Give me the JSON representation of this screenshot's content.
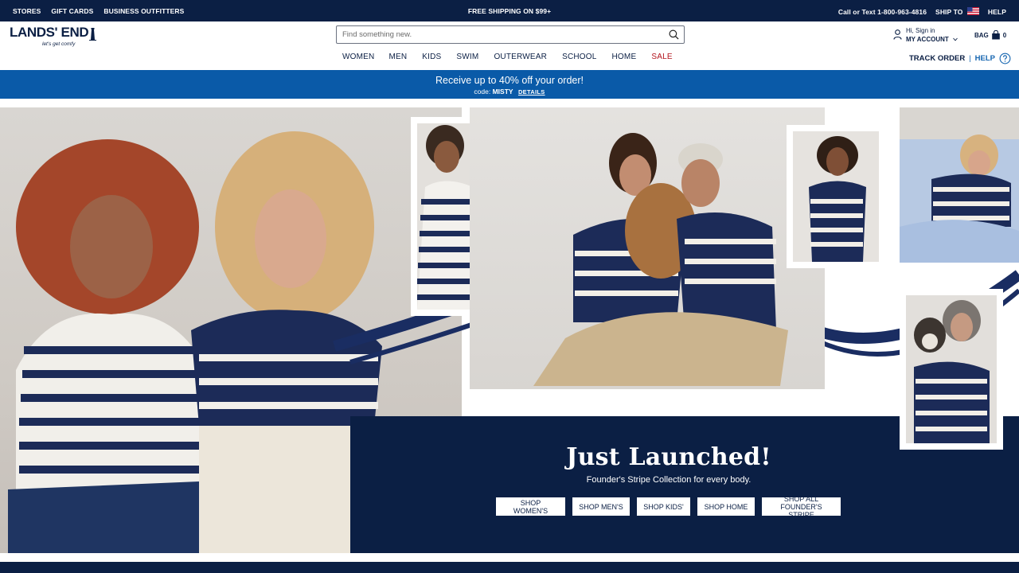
{
  "utility": {
    "left_links": [
      "STORES",
      "GIFT CARDS",
      "BUSINESS OUTFITTERS"
    ],
    "shipping": "FREE SHIPPING ON $99+",
    "phone": "Call or Text 1-800-963-4816",
    "ship_to": "SHIP TO",
    "help": "HELP"
  },
  "header": {
    "logo": "LANDS' END",
    "tagline": "let's get comfy",
    "search_placeholder": "Find something new.",
    "account_greeting": "Hi, Sign in",
    "account_label": "MY ACCOUNT",
    "bag_label": "BAG",
    "bag_count": "0",
    "nav": [
      "WOMEN",
      "MEN",
      "KIDS",
      "SWIM",
      "OUTERWEAR",
      "SCHOOL",
      "HOME",
      "SALE"
    ],
    "track_order": "TRACK ORDER",
    "separator": "|",
    "help": "HELP"
  },
  "promo": {
    "headline": "Receive up to 40% off your order!",
    "code_prefix": "code:",
    "code": "MISTY",
    "details": "DETAILS"
  },
  "hero": {
    "title": "Just Launched!",
    "subtitle": "Founder's Stripe Collection for every body.",
    "buttons": [
      "SHOP WOMEN'S",
      "SHOP MEN'S",
      "SHOP KIDS'",
      "SHOP HOME",
      "SHOP ALL FOUNDER'S STRIPE"
    ]
  },
  "colors": {
    "navy": "#0b1f44",
    "promo_blue": "#0a5aa8",
    "sale_red": "#b3141d",
    "link_blue": "#1565b0"
  }
}
